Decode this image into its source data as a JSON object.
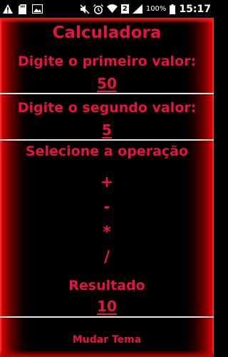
{
  "status_bar": {
    "time": "15:17",
    "battery": "100%",
    "sim_number": "2",
    "left_icons": [
      "warning-icon",
      "sd-card-icon",
      "image-icon"
    ],
    "right_icons": [
      "mute-icon",
      "alarm-icon",
      "wifi-icon",
      "sim-icon",
      "signal-icon",
      "battery-icon"
    ]
  },
  "app": {
    "title": "Calculadora",
    "first_label": "Digite o primeiro valor:",
    "first_value": "50",
    "second_label": "Digite o segundo valor:",
    "second_value": "5",
    "operation_label": "Selecione a operação",
    "operations": {
      "add": "+",
      "subtract": "-",
      "multiply": "*",
      "divide": "/"
    },
    "result_label": "Resultado",
    "result_value": "10",
    "theme_button": "Mudar Tema"
  },
  "colors": {
    "accent": "#e8123f",
    "edge_red": "#d40000",
    "background": "#000000",
    "separator": "#e8e8e8"
  }
}
